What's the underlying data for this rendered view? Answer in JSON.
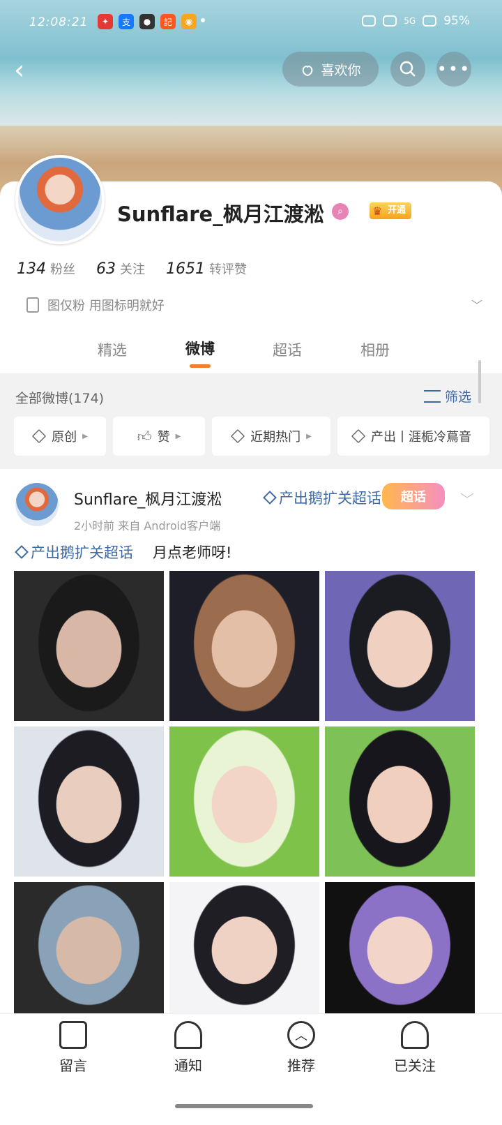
{
  "status_bar": {
    "time": "12:08:21",
    "app_icons": [
      {
        "name": "app-icon-1",
        "glyph": "✦",
        "color": "#e53935"
      },
      {
        "name": "app-icon-alipay",
        "glyph": "支",
        "color": "#1677ff"
      },
      {
        "name": "app-icon-qq",
        "glyph": "●",
        "color": "#333333"
      },
      {
        "name": "app-icon-4",
        "glyph": "記",
        "color": "#ff5722"
      },
      {
        "name": "app-icon-weibo",
        "glyph": "◉",
        "color": "#f5a623"
      }
    ],
    "signal_text": "5G",
    "battery": "95%"
  },
  "header": {
    "back_label": "‹",
    "like_label": "喜欢你",
    "search_label": "⌕",
    "more_label": "•••"
  },
  "profile": {
    "username": "Sunflare_枫月江渡淞",
    "vip_label": "开通",
    "fans_count": "134",
    "fans_label": "粉丝",
    "following_count": "63",
    "following_label": "关注",
    "likes_count": "1651",
    "likes_label": "转评赞",
    "bio": "图仅粉 用图标明就好"
  },
  "tabs": [
    {
      "label": "精选",
      "active": false
    },
    {
      "label": "微博",
      "active": true
    },
    {
      "label": "超话",
      "active": false
    },
    {
      "label": "相册",
      "active": false
    }
  ],
  "filters": {
    "all_label": "全部微博(174)",
    "filter_label": "筛选",
    "chips": [
      {
        "label": "原创"
      },
      {
        "label": "赞"
      },
      {
        "label": "近期热门"
      },
      {
        "label": "产出丨涯栀冷蔦音"
      }
    ]
  },
  "post": {
    "user": "Sunflare_枫月江渡淞",
    "topic": "产出鹅扩关超话",
    "badge": "超话",
    "meta": "2小时前  来自 Android客户端",
    "text_topic": "产出鹅扩关超话",
    "text_body": "月点老师呀!"
  },
  "photos": [
    {
      "name": "photo-1",
      "colors": [
        "#2b2b2b",
        "#d9b7a6",
        "#1a1a1a"
      ]
    },
    {
      "name": "photo-2",
      "colors": [
        "#1e1e28",
        "#e3bfa8",
        "#9b6c4e"
      ]
    },
    {
      "name": "photo-3",
      "colors": [
        "#6f66b5",
        "#f0d0c0",
        "#1b1b22"
      ]
    },
    {
      "name": "photo-4",
      "colors": [
        "#dfe3ea",
        "#e9cdbf",
        "#1c1c22"
      ]
    },
    {
      "name": "photo-5",
      "colors": [
        "#7ec24a",
        "#f2d5c6",
        "#e9f4d4"
      ]
    },
    {
      "name": "photo-6",
      "colors": [
        "#7dc157",
        "#f0cfbf",
        "#16161c"
      ]
    },
    {
      "name": "photo-7",
      "colors": [
        "#2a2a2a",
        "#d7b9a8",
        "#8aa2b8"
      ]
    },
    {
      "name": "photo-8",
      "colors": [
        "#f4f4f6",
        "#efd2c4",
        "#1e1e24"
      ]
    },
    {
      "name": "photo-9",
      "colors": [
        "#111111",
        "#f2d4c8",
        "#8c72c7"
      ]
    }
  ],
  "bottom_nav": [
    {
      "label": "留言",
      "icon": "message-icon"
    },
    {
      "label": "通知",
      "icon": "bell-icon"
    },
    {
      "label": "推荐",
      "icon": "recommend-icon"
    },
    {
      "label": "已关注",
      "icon": "followed-icon"
    }
  ]
}
